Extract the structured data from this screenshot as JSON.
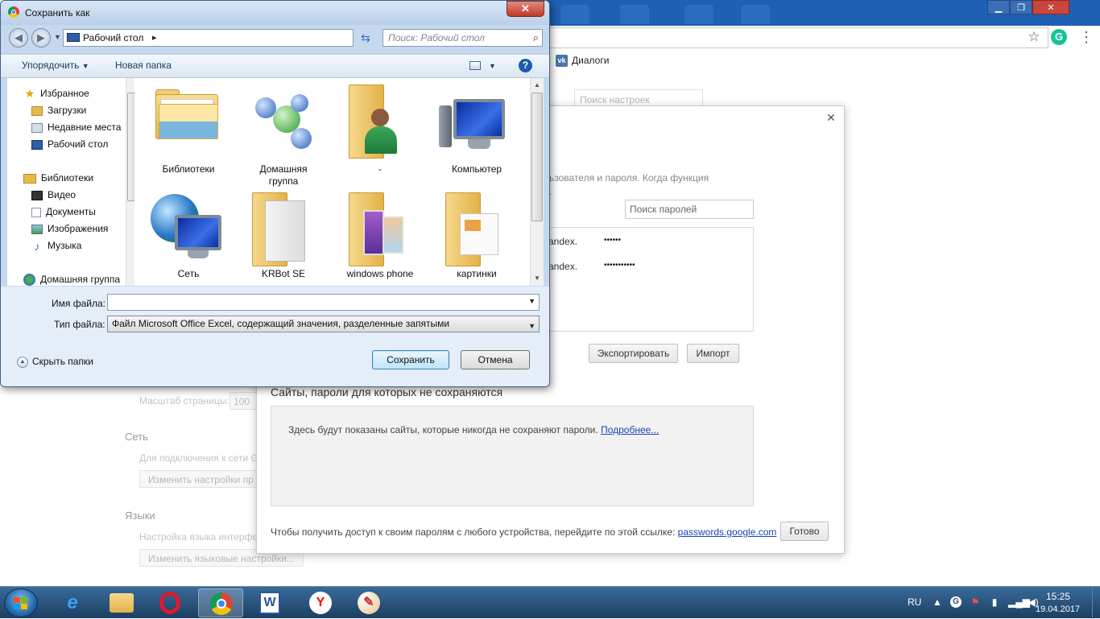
{
  "browser": {
    "bookmark_label": "Диалоги",
    "settings_search_placeholder": "Поиск настроек",
    "bg": {
      "zoom_label": "Масштаб страницы:",
      "zoom_value": "100",
      "network_head": "Сеть",
      "network_text": "Для подключения к сети G",
      "network_btn": "Изменить настройки пр",
      "lang_head": "Языки",
      "lang_text": "Настройка языка интерфе",
      "lang_btn": "Изменить языковые настройки..."
    }
  },
  "password_dialog": {
    "desc_line1": "льзователя и пароля. Когда функция",
    "desc_line2": "е.",
    "search_placeholder": "Поиск паролей",
    "rows": [
      {
        "site": "andex.",
        "password": "••••••"
      },
      {
        "site": "andex.",
        "password": "•••••••••••"
      }
    ],
    "export_label": "Экспортировать",
    "import_label": "Импорт",
    "never_title": "Сайты, пароли для которых не сохраняются",
    "never_text": "Здесь будут показаны сайты, которые никогда не сохраняют пароли.",
    "never_link": "Подробнее...",
    "footer_text": "Чтобы получить доступ к своим паролям с любого устройства, перейдите по этой ссылке:",
    "footer_link": "passwords.google.com",
    "done_label": "Готово"
  },
  "save_dialog": {
    "title": "Сохранить как",
    "address": "Рабочий стол",
    "search_placeholder": "Поиск: Рабочий стол",
    "toolbar": {
      "organize": "Упорядочить",
      "new_folder": "Новая папка"
    },
    "nav": {
      "favorites": "Избранное",
      "downloads": "Загрузки",
      "recent": "Недавние места",
      "desktop": "Рабочий стол",
      "libraries": "Библиотеки",
      "video": "Видео",
      "documents": "Документы",
      "images": "Изображения",
      "music": "Музыка",
      "homegroup": "Домашняя группа"
    },
    "files": {
      "libraries": "Библиотеки",
      "homegroup_line1": "Домашняя",
      "homegroup_line2": "группа",
      "user": "-",
      "computer": "Компьютер",
      "network": "Сеть",
      "krbot": "KRBot SE",
      "winphone": "windows phone",
      "pictures": "картинки"
    },
    "filename_label": "Имя файла:",
    "filename_value": "",
    "filetype_label": "Тип файла:",
    "filetype_value": "Файл Microsoft Office Excel, содержащий значения, разделенные запятыми",
    "hide_folders": "Скрыть папки",
    "save_label": "Сохранить",
    "cancel_label": "Отмена"
  },
  "taskbar": {
    "lang": "RU",
    "time": "15:25",
    "date": "19.04.2017"
  }
}
